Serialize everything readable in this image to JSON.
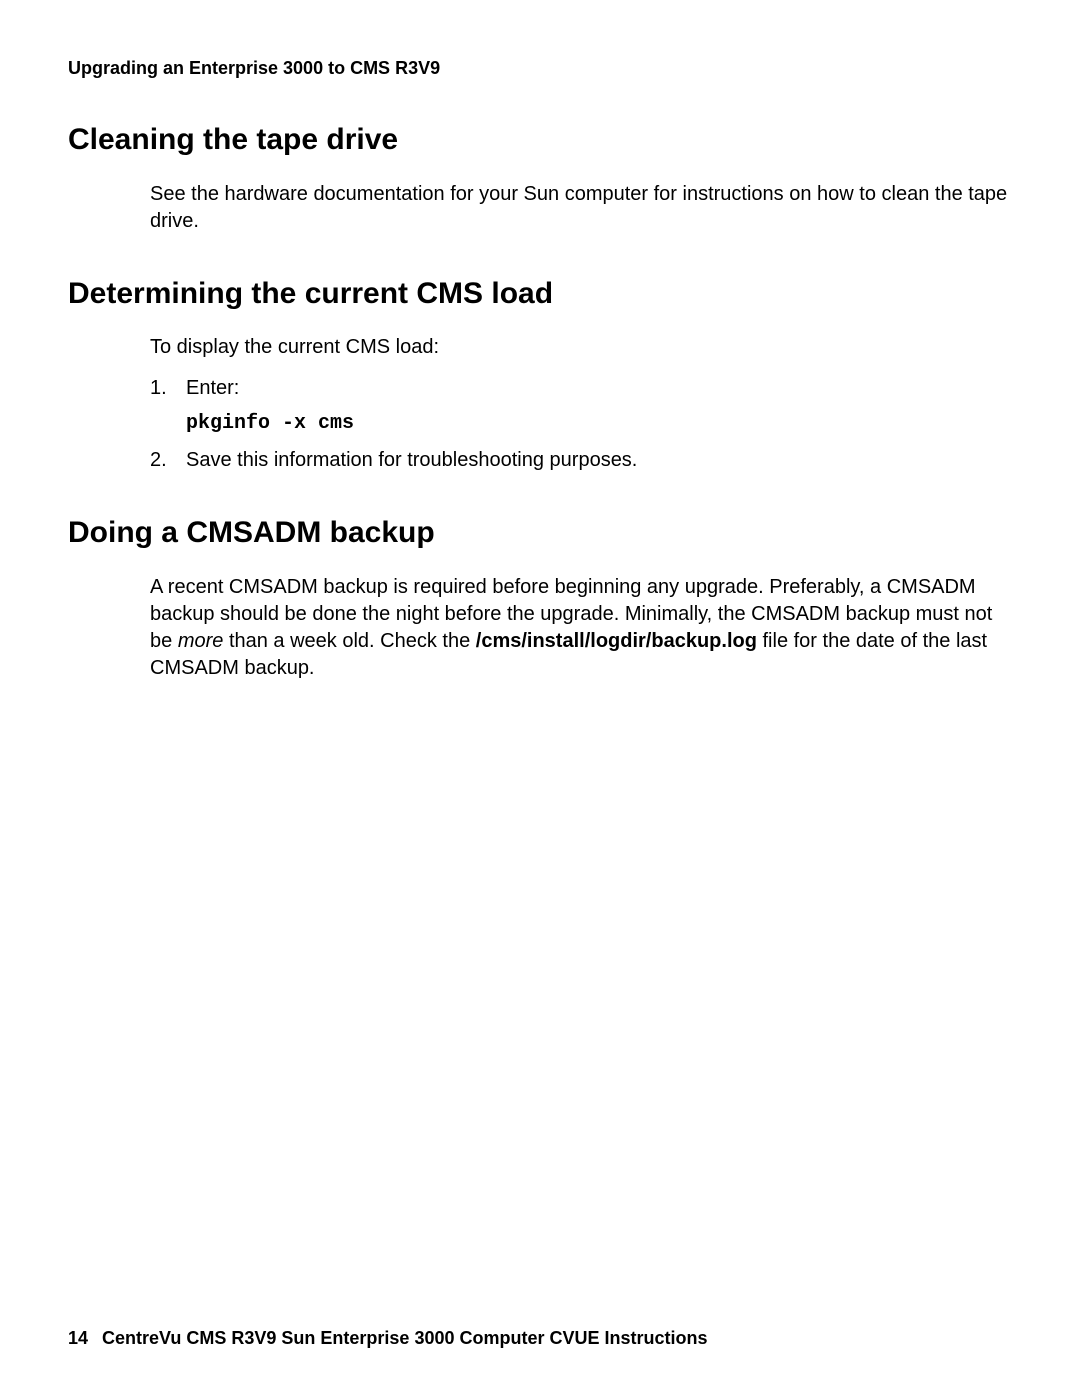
{
  "header": {
    "running_title": "Upgrading an Enterprise 3000 to CMS R3V9"
  },
  "sections": {
    "cleaning": {
      "heading": "Cleaning the tape drive",
      "para": "See the hardware documentation for your Sun computer for instructions on how to clean the tape drive."
    },
    "determining": {
      "heading": "Determining the current CMS load",
      "intro": "To display the current CMS load:",
      "step1_num": "1.",
      "step1_text": "Enter:",
      "step1_code": "pkginfo -x cms",
      "step2_num": "2.",
      "step2_text": "Save this information for troubleshooting purposes."
    },
    "backup": {
      "heading": "Doing a CMSADM  backup",
      "para_pre": "A recent CMSADM backup is required before beginning any upgrade. Preferably, a CMSADM backup should be done the night before the upgrade. Minimally, the CMSADM backup must not be ",
      "para_italic": "more",
      "para_mid": " than a week old. Check the ",
      "para_bold": "/cms/install/logdir/backup.log",
      "para_post": " file for the date of the last CMSADM backup."
    }
  },
  "footer": {
    "page_number": "14",
    "title": "CentreVu CMS R3V9 Sun Enterprise 3000 Computer CVUE Instructions"
  }
}
